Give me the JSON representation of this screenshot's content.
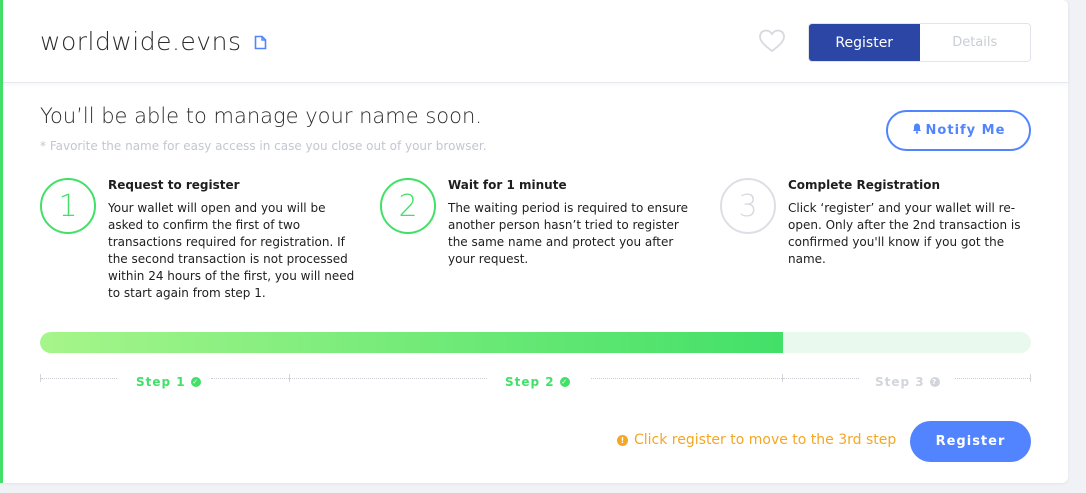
{
  "header": {
    "domain_name": "worldwide.evns",
    "tabs": [
      {
        "label": "Register",
        "active": true
      },
      {
        "label": "Details",
        "active": false
      }
    ]
  },
  "main": {
    "title": "You’ll be able to manage your name soon.",
    "subtitle": "* Favorite the name for easy access in case you close out of your browser.",
    "notify_label": "Notify Me",
    "steps": [
      {
        "number": "1",
        "title": "Request to register",
        "description": "Your wallet will open and you will be asked to confirm the first of two transactions required for registration. If the second transaction is not processed within 24 hours of the first, you will need to start again from step 1.",
        "status": "done"
      },
      {
        "number": "2",
        "title": "Wait for 1 minute",
        "description": "The waiting period is required to ensure another person hasn’t tried to register the same name and protect you after your request.",
        "status": "done"
      },
      {
        "number": "3",
        "title": "Complete Registration",
        "description": "Click ‘register’ and your wallet will re-open. Only after the 2nd transaction is confirmed you'll know if you got the name.",
        "status": "pending"
      }
    ],
    "progress_fraction": 0.75,
    "step_labels": [
      "Step 1",
      "Step 2",
      "Step 3"
    ],
    "hint": "Click register to move to the 3rd step",
    "register_label": "Register"
  },
  "colors": {
    "accent_blue": "#5284ff",
    "active_tab": "#2c46a6",
    "success_green": "#42e068",
    "warning_orange": "#f5a623"
  },
  "icons": [
    "document-icon",
    "heart-icon",
    "bell-icon",
    "check-icon",
    "question-icon",
    "warning-icon"
  ]
}
